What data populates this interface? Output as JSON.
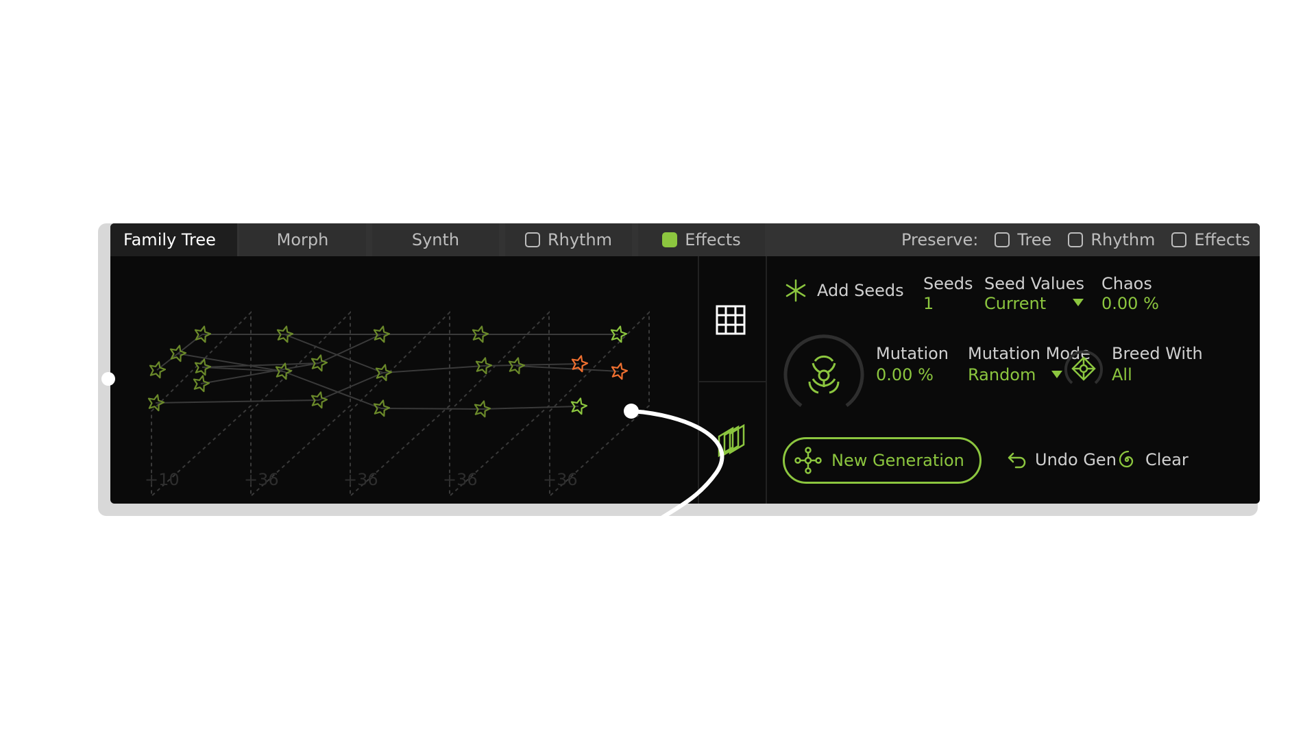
{
  "tabs": [
    {
      "label": "Family Tree",
      "active": true,
      "checkbox": null
    },
    {
      "label": "Morph",
      "active": false,
      "checkbox": null
    },
    {
      "label": "Synth",
      "active": false,
      "checkbox": null
    },
    {
      "label": "Rhythm",
      "active": false,
      "checkbox": false
    },
    {
      "label": "Effects",
      "active": false,
      "checkbox": true
    }
  ],
  "preserve": {
    "label": "Preserve:",
    "options": [
      {
        "label": "Tree",
        "checked": false
      },
      {
        "label": "Rhythm",
        "checked": false
      },
      {
        "label": "Effects",
        "checked": false
      }
    ]
  },
  "tree": {
    "generation_labels": [
      "+10",
      "+36",
      "+36",
      "+36",
      "+36"
    ]
  },
  "controls": {
    "add_seeds": "Add Seeds",
    "seeds": {
      "label": "Seeds",
      "value": "1"
    },
    "seed_values": {
      "label": "Seed Values",
      "value": "Current"
    },
    "chaos": {
      "label": "Chaos",
      "value": "0.00 %"
    },
    "mutation": {
      "label": "Mutation",
      "value": "0.00 %"
    },
    "mutation_mode": {
      "label": "Mutation Mode",
      "value": "Random"
    },
    "breed_with": {
      "label": "Breed With",
      "value": "All"
    },
    "new_generation": "New Generation",
    "undo_gen": "Undo Gen",
    "clear": "Clear"
  },
  "icons": {
    "add_seeds": "asterisk-icon",
    "mutation": "biohazard-icon",
    "breed": "breed-diamond-icon",
    "new_generation": "molecule-icon",
    "undo": "undo-arrow-icon",
    "clear": "spiral-icon",
    "grid_view": "grid-icon",
    "layers_view": "layers-icon"
  },
  "colors": {
    "accent": "#8cc63f",
    "selected_node": "#f07030",
    "background": "#0a0a0a",
    "tabbar": "#333333"
  }
}
